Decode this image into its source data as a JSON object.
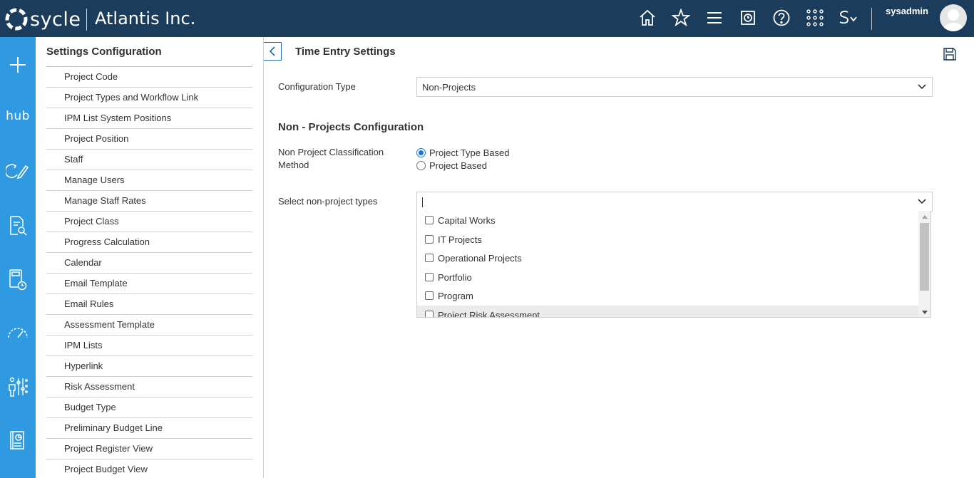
{
  "header": {
    "logo_text": "sycle",
    "company": "Atlantis Inc.",
    "username": "sysadmin",
    "icons": [
      "home-icon",
      "star-icon",
      "menu-icon",
      "clock-screen-icon",
      "help-icon",
      "apps-grid-icon",
      "s-dropdown-icon"
    ]
  },
  "rail": {
    "hub_label": "hub",
    "icons": [
      "plus-icon",
      "hub-icon",
      "refresh-edit-icon",
      "document-search-icon",
      "calculator-clock-icon",
      "gauge-icon",
      "people-sliders-icon",
      "report-icon"
    ]
  },
  "settings": {
    "title": "Settings Configuration",
    "items": [
      "Project Code",
      "Project Types and Workflow Link",
      "IPM List System Positions",
      "Project Position",
      "Staff",
      "Manage Users",
      "Manage Staff Rates",
      "Project Class",
      "Progress Calculation",
      "Calendar",
      "Email Template",
      "Email Rules",
      "Assessment Template",
      "IPM Lists",
      "Hyperlink",
      "Risk Assessment",
      "Budget Type",
      "Preliminary Budget Line",
      "Project Register View",
      "Project Budget View"
    ]
  },
  "main": {
    "title": "Time Entry Settings",
    "config_type_label": "Configuration Type",
    "config_type_value": "Non-Projects",
    "section_title": "Non - Projects Configuration",
    "classification_label_line1": "Non Project Classification",
    "classification_label_line2": "Method",
    "radio_options": [
      {
        "label": "Project Type Based",
        "checked": true
      },
      {
        "label": "Project Based",
        "checked": false
      }
    ],
    "select_types_label": "Select non-project types",
    "select_types_value": "",
    "type_options": [
      {
        "label": "Capital Works",
        "checked": false
      },
      {
        "label": "IT Projects",
        "checked": false
      },
      {
        "label": "Operational Projects",
        "checked": false
      },
      {
        "label": "Portfolio",
        "checked": false
      },
      {
        "label": "Program",
        "checked": false
      },
      {
        "label": "Project Risk Assessment",
        "checked": false
      }
    ]
  },
  "colors": {
    "topbar": "#1c3c5c",
    "rail": "#2f9ae1",
    "accent": "#1a73e8"
  }
}
